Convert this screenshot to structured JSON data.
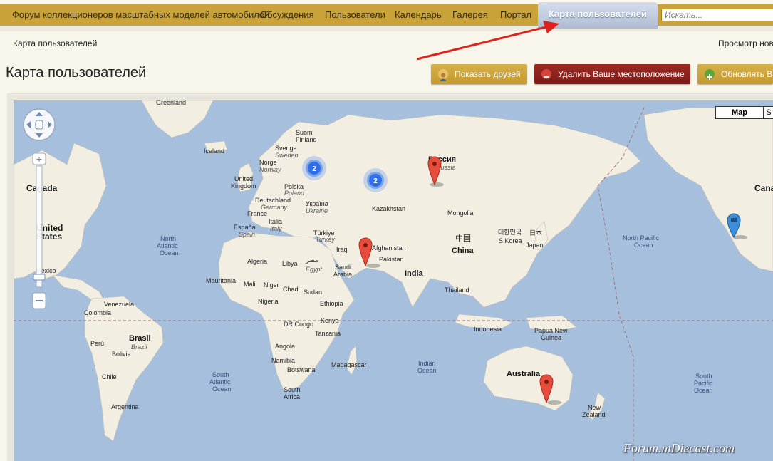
{
  "nav": {
    "items": [
      "Форум коллекционеров масштабных моделей автомобилей",
      "Обсуждения",
      "Пользователи",
      "Календарь",
      "Галерея",
      "Портал"
    ],
    "active": "Карта пользователей",
    "search_placeholder": "Искать..."
  },
  "breadcrumb": "Карта пользователей",
  "viewing": "Просмотр нов",
  "page_title": "Карта пользователей",
  "buttons": {
    "show_friends": "Показать друзей",
    "delete_location": "Удалить Ваше местоположение",
    "update": "Обновлять Ва"
  },
  "map": {
    "type_map": "Map",
    "type_other": "S",
    "labels": {
      "greenland": "Greenland",
      "iceland": "Iceland",
      "canada": "Canada",
      "canada2": "Cana",
      "united": "United",
      "states": "States",
      "mexico": "Mexico",
      "suomi": "Suomi",
      "finland": "Finland",
      "sverige": "Sverige",
      "sweden": "Sweden",
      "norge": "Norge",
      "norway": "Norway",
      "united_kingdom1": "United",
      "united_kingdom2": "Kingdom",
      "polska": "Polska",
      "poland": "Poland",
      "deutschland": "Deutschland",
      "germany": "Germany",
      "ukraina": "Україна",
      "ukraine": "Ukraine",
      "france": "France",
      "espana": "España",
      "spain": "Spain",
      "italia": "Italia",
      "italy": "Italy",
      "turkiye": "Türkiye",
      "turkey": "Turkey",
      "rossiya": "Россия",
      "russia": "Russia",
      "kazakhstan": "Kazakhstan",
      "mongolia": "Mongolia",
      "china": "China",
      "china_cn": "中国",
      "korea_kr": "대한민국",
      "s_korea": "S.Korea",
      "japan_jp": "日本",
      "japan": "Japan",
      "iraq": "Iraq",
      "afghanistan": "Afghanistan",
      "pakistan": "Pakistan",
      "india": "India",
      "saudi1": "Saudi",
      "saudi2": "Arabia",
      "misr": "مصر",
      "egypt": "Egypt",
      "algeria": "Algeria",
      "libya": "Libya",
      "mauritania": "Mauritania",
      "mali": "Mali",
      "niger": "Niger",
      "chad": "Chad",
      "sudan": "Sudan",
      "ethiopia": "Ethiopia",
      "nigeria": "Nigeria",
      "kenya": "Kenya",
      "dr_congo": "DR Congo",
      "tanzania": "Tanzania",
      "angola": "Angola",
      "namibia": "Namibia",
      "botswana": "Botswana",
      "south_africa1": "South",
      "south_africa2": "Africa",
      "madagascar": "Madagascar",
      "thailand": "Thailand",
      "indonesia": "Indonesia",
      "papua1": "Papua New",
      "papua2": "Guinea",
      "australia": "Australia",
      "new_zealand1": "New",
      "new_zealand2": "Zealand",
      "venezuela": "Venezuela",
      "colombia": "Colombia",
      "peru": "Perú",
      "brasil": "Brasil",
      "brazil": "Brazil",
      "bolivia": "Bolivia",
      "chile": "Chile",
      "argentina": "Argentina",
      "north_atlantic1": "North",
      "north_atlantic2": "Atlantic",
      "north_atlantic3": "Ocean",
      "south_atlantic1": "South",
      "south_atlantic2": "Atlantic",
      "south_atlantic3": "Ocean",
      "indian1": "Indian",
      "indian2": "Ocean",
      "north_pacific1": "North Pacific",
      "north_pacific2": "Ocean",
      "south_pacific1": "South",
      "south_pacific2": "Pacific",
      "south_pacific3": "Ocean"
    },
    "clusters": [
      "2",
      "2"
    ]
  },
  "watermark": "Forum.mDiecast.com",
  "colors": {
    "nav_gold": "#c9a23a",
    "active_tab": "#aebbd2",
    "btn_gold": "#c49a2e",
    "btn_red": "#8a221c",
    "water": "#a5bfdd",
    "land": "#f3efe5",
    "pin_red": "#e74c3c",
    "cluster_blue": "#2f6fe8"
  }
}
